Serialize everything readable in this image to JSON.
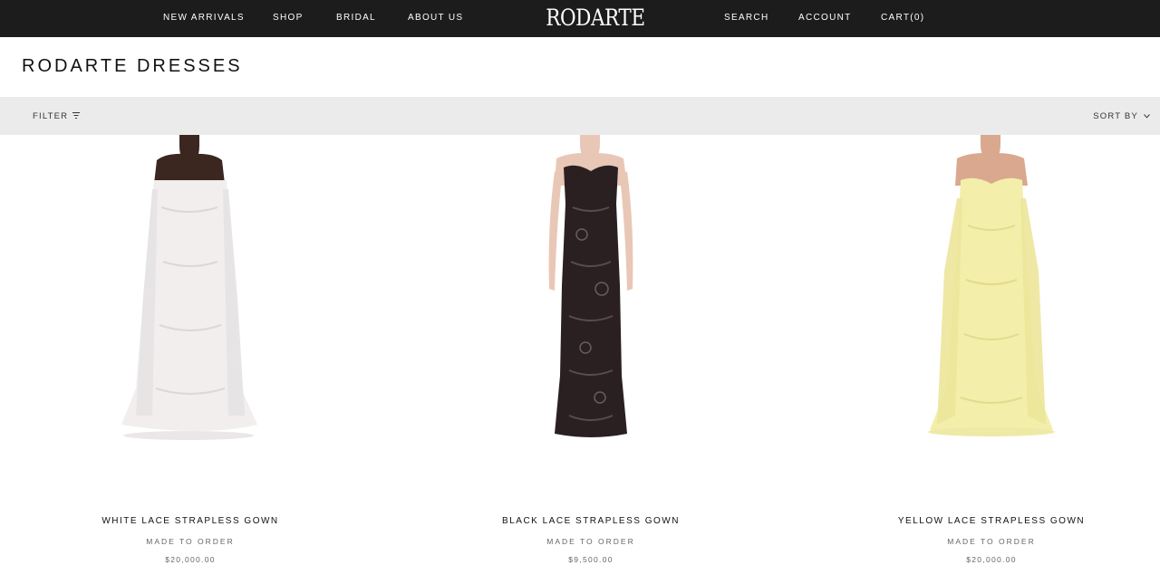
{
  "nav": {
    "left": [
      "NEW ARRIVALS",
      "SHOP",
      "BRIDAL",
      "ABOUT US"
    ],
    "logo": "RODARTE",
    "right": [
      "SEARCH",
      "ACCOUNT",
      "CART(0)"
    ]
  },
  "page": {
    "title": "RODARTE DRESSES"
  },
  "toolbar": {
    "filter_label": "FILTER",
    "filter_icon": "filter-icon",
    "sort_label": "SORT BY",
    "sort_icon": "chevron-down-icon"
  },
  "products": [
    {
      "name": "WHITE LACE STRAPLESS GOWN",
      "status": "MADE TO ORDER",
      "price": "$20,000.00",
      "dress_color": "#f1eeed"
    },
    {
      "name": "BLACK LACE STRAPLESS GOWN",
      "status": "MADE TO ORDER",
      "price": "$9,500.00",
      "dress_color": "#2a2022"
    },
    {
      "name": "YELLOW LACE STRAPLESS GOWN",
      "status": "MADE TO ORDER",
      "price": "$20,000.00",
      "dress_color": "#f3eeaa"
    }
  ],
  "colors": {
    "topbar": "#1c1c1c",
    "filterbar": "#ebebeb"
  }
}
